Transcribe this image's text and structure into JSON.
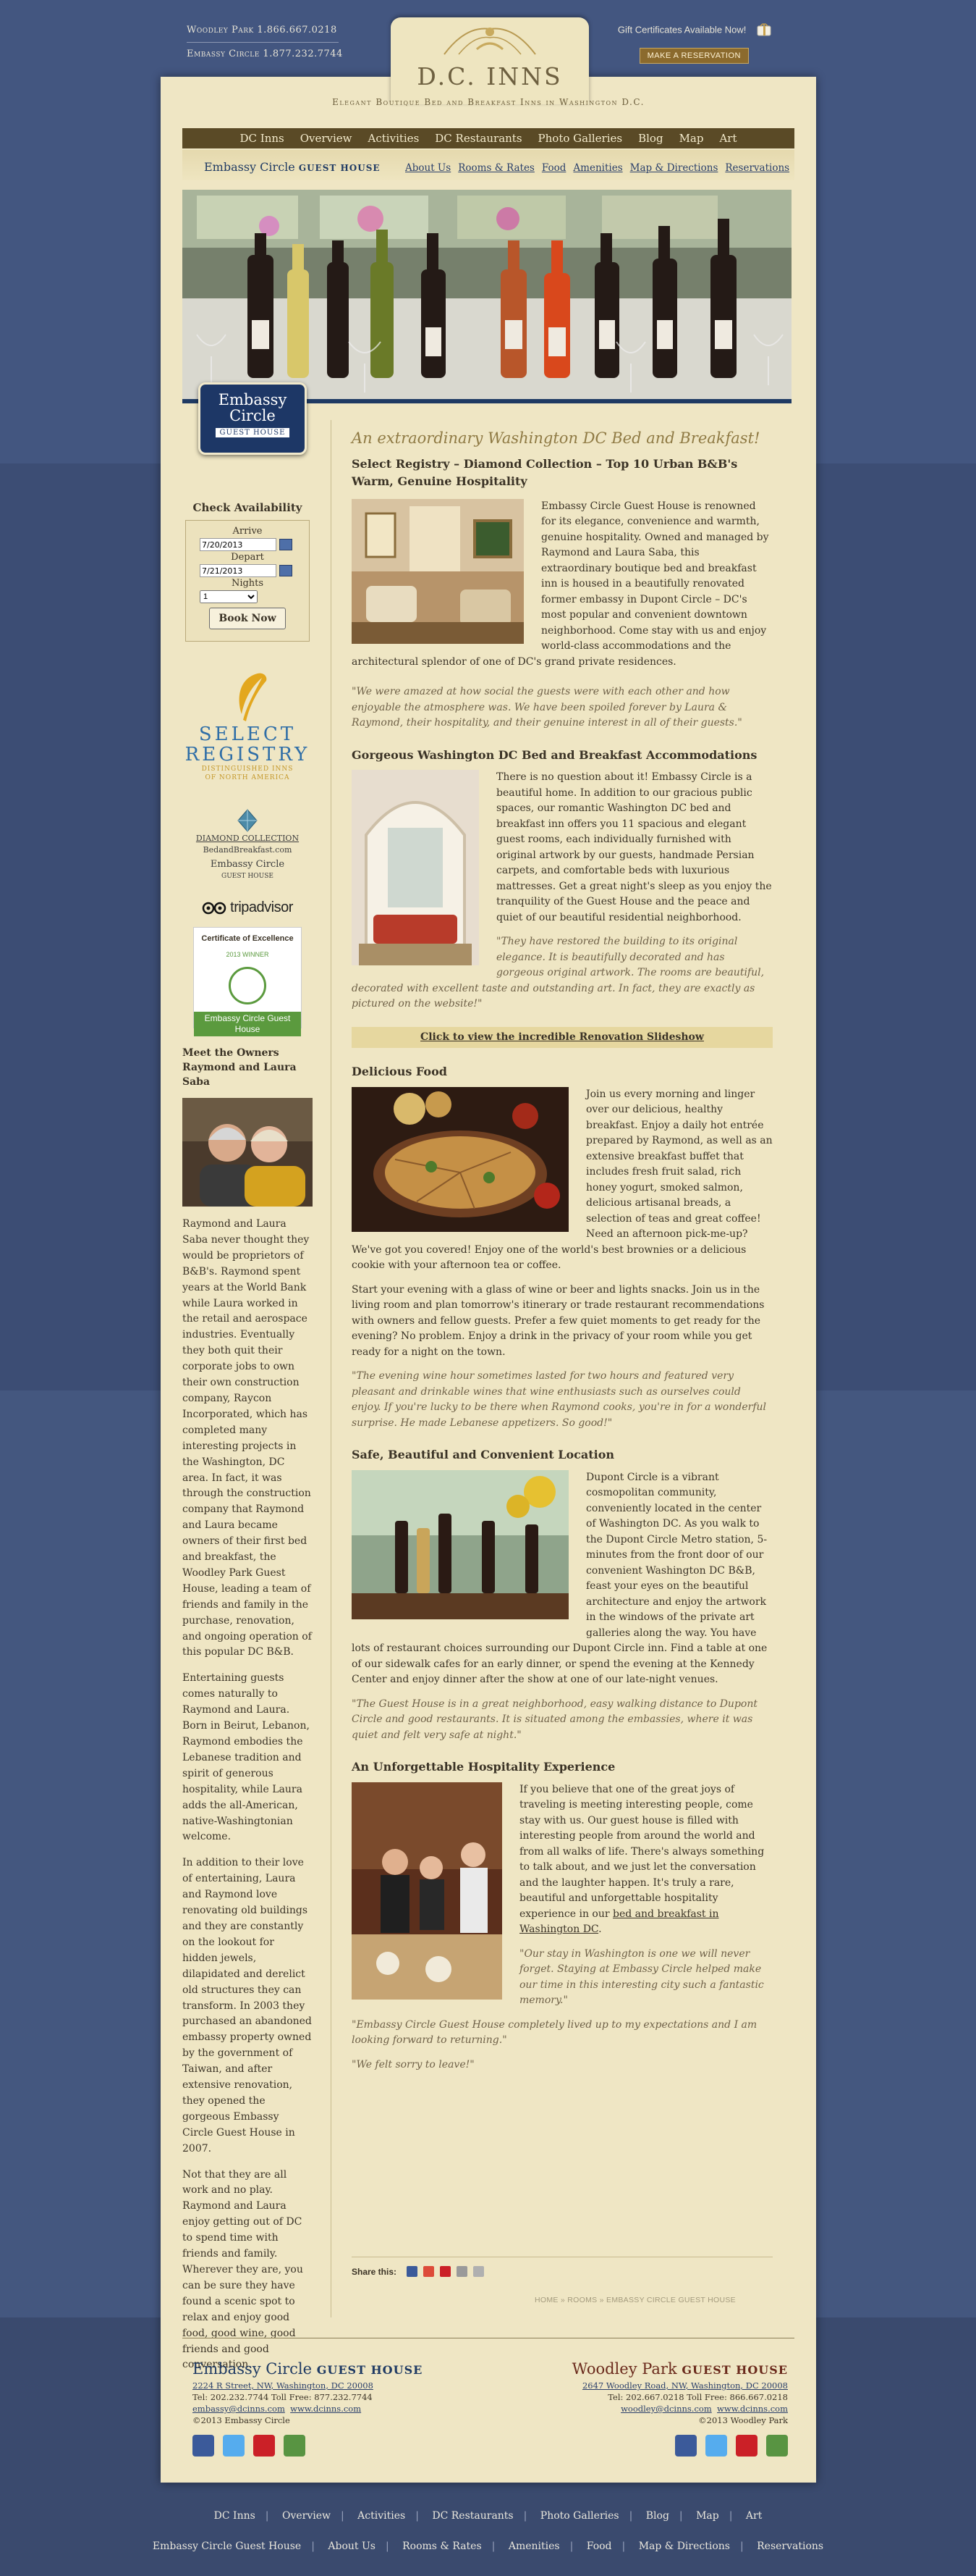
{
  "top": {
    "phone1_label": "Woodley Park",
    "phone1_number": "1.866.667.0218",
    "phone2_label": "Embassy Circle",
    "phone2_number": "1.877.232.7744",
    "gift_text": "Gift Certificates Available Now!",
    "reserve_label": "MAKE A RESERVATION"
  },
  "brand": {
    "title": "D.C. INNS",
    "tagline": "Elegant Boutique Bed and Breakfast Inns in Washington D.C."
  },
  "main_nav": [
    "DC Inns",
    "Overview",
    "Activities",
    "DC Restaurants",
    "Photo Galleries",
    "Blog",
    "Map",
    "Art"
  ],
  "property": {
    "logo_name": "Embassy Circle",
    "logo_suffix": "GUEST HOUSE",
    "badge_line1": "Embassy",
    "badge_line2": "Circle",
    "badge_line3": "GUEST HOUSE"
  },
  "sub_nav": [
    "About Us",
    "Rooms & Rates",
    "Food",
    "Amenities",
    "Map & Directions",
    "Reservations"
  ],
  "sidebar": {
    "availability_title": "Check Availability",
    "arrive_label": "Arrive",
    "arrive_value": "7/20/2013",
    "depart_label": "Depart",
    "depart_value": "7/21/2013",
    "nights_label": "Nights",
    "nights_value": "1",
    "book_label": "Book Now",
    "select_registry_1": "SELECT",
    "select_registry_2": "REGISTRY",
    "select_registry_3": "DISTINGUISHED INNS",
    "select_registry_4": "OF NORTH AMERICA",
    "diamond_1": "DIAMOND COLLECTION",
    "diamond_2": "BedandBreakfast.com",
    "diamond_3": "Embassy Circle",
    "diamond_4": "GUEST HOUSE",
    "tripadvisor": "tripadvisor",
    "cert_1": "Certificate of Excellence",
    "cert_2": "2013 WINNER",
    "cert_3": "Embassy Circle Guest House",
    "owners_heading_1": "Meet the Owners",
    "owners_heading_2": "Raymond and Laura Saba",
    "owners_paragraphs": [
      "Raymond and Laura Saba never thought they would be proprietors of B&B's. Raymond spent years at the World Bank while Laura worked in the retail and aerospace industries. Eventually they both quit their corporate jobs to own their own construction company, Raycon Incorporated, which has completed many interesting projects in the Washington, DC area. In fact, it was through the construction company that Raymond and Laura became owners of their first bed and breakfast, the Woodley Park Guest House, leading a team of friends and family in the purchase, renovation, and ongoing operation of this popular DC B&B.",
      "Entertaining guests comes naturally to Raymond and Laura. Born in Beirut, Lebanon, Raymond embodies the Lebanese tradition and spirit of generous hospitality, while Laura adds the all-American, native-Washingtonian welcome.",
      "In addition to their love of entertaining, Laura and Raymond love renovating old buildings and they are constantly on the lookout for hidden jewels, dilapidated and derelict old structures they can transform. In 2003 they purchased an abandoned embassy property owned by the government of Taiwan, and after extensive renovation, they opened the gorgeous Embassy Circle Guest House in 2007.",
      "Not that they are all work and no play. Raymond and Laura enjoy getting out of DC to spend time with friends and family. Wherever they are, you can be sure they have found a scenic spot to relax and enjoy good food, good wine, good friends and good conversation."
    ]
  },
  "content": {
    "headline": "An extraordinary Washington DC Bed and Breakfast!",
    "subhead1": "Select Registry – Diamond Collection – Top 10 Urban B&B's",
    "subhead2": "Warm, Genuine Hospitality",
    "p1": "Embassy Circle Guest House is renowned for its elegance, convenience and warmth, genuine hospitality. Owned and managed by Raymond and Laura Saba, this extraordinary boutique bed and breakfast inn is housed in a beautifully renovated former embassy in Dupont Circle – DC's most popular and convenient downtown neighborhood. Come stay with us and enjoy world-class accommodations and the architectural splendor of one of DC's grand private residences.",
    "q1": "\"We were amazed at how social the guests were with each other and how enjoyable the atmosphere was. We have been spoiled forever by Laura & Raymond, their hospitality, and their genuine interest in all of their guests.\"",
    "h_accom": "Gorgeous Washington DC Bed and Breakfast Accommodations",
    "p2": "There is no question about it! Embassy Circle is a beautiful home. In addition to our gracious public spaces, our romantic Washington DC bed and breakfast inn offers you 11 spacious and elegant guest rooms, each individually furnished with original artwork by our guests, handmade Persian carpets, and comfortable beds with luxurious mattresses. Get a great night's sleep as you enjoy the tranquility of the Guest House and the peace and quiet of our beautiful residential neighborhood.",
    "q2": "\"They have restored the building to its original elegance. It is beautifully decorated and has gorgeous original artwork. The rooms are beautiful, decorated with excellent taste and outstanding art. In fact, they are exactly as pictured on the website!\"",
    "slideshow_link": "Click to view the incredible Renovation Slideshow",
    "h_food": "Delicious Food",
    "p3": "Join us every morning and linger over our delicious, healthy breakfast. Enjoy a daily hot entrée prepared by Raymond, as well as an extensive breakfast buffet that includes fresh fruit salad, rich honey yogurt, smoked salmon, delicious artisanal breads, a selection of teas and great coffee! Need an afternoon pick-me-up? We've got you covered! Enjoy one of the world's best brownies or a delicious cookie with your afternoon tea or coffee.",
    "p4": "Start your evening with a glass of wine or beer and lights snacks. Join us in the living room and plan tomorrow's itinerary or trade restaurant recommendations with owners and fellow guests. Prefer a few quiet moments to get ready for the evening? No problem. Enjoy a drink in the privacy of your room while you get ready for a night on the town.",
    "q3": "\"The evening wine hour sometimes lasted for two hours and featured very pleasant and drinkable wines that wine enthusiasts such as ourselves could enjoy. If you're lucky to be there when Raymond cooks, you're in for a wonderful surprise. He made Lebanese appetizers. So good!\"",
    "h_safe": "Safe, Beautiful and Convenient Location",
    "p5": "Dupont Circle is a vibrant cosmopolitan community, conveniently located in the center of Washington DC. As you walk to the Dupont Circle Metro station, 5-minutes from the front door of our convenient Washington DC B&B, feast your eyes on the beautiful architecture and enjoy the artwork in the windows of the private art galleries along the way. You have lots of restaurant choices surrounding our Dupont Circle inn. Find a table at one of our sidewalk cafes for an early dinner, or spend the evening at the Kennedy Center and enjoy dinner after the show at one of our late-night venues.",
    "q4": "\"The Guest House is in a great neighborhood, easy walking distance to Dupont Circle and good restaurants. It is situated among the embassies, where it was quiet and felt very safe at night.\"",
    "h_exp": "An Unforgettable Hospitality Experience",
    "p6_before": "If you believe that one of the great joys of traveling is meeting interesting people, come stay with us. Our guest house is filled with interesting people from around the world and from all walks of life. There's always something to talk about, and we just let the conversation and the laughter happen. It's truly a rare, beautiful and unforgettable hospitality experience in our ",
    "p6_link": "bed and breakfast in Washington DC",
    "p6_after": ".",
    "q5": "\"Our stay in Washington is one we will never forget. Staying at Embassy Circle helped make our time in this interesting city such a fantastic memory.\"",
    "q6": "\"Embassy Circle Guest House completely lived up to my expectations and I am looking forward to returning.\"",
    "q7": "\"We felt sorry to leave!\"",
    "share_label": "Share this:",
    "breadcrumb": "HOME » ROOMS » EMBASSY CIRCLE GUEST HOUSE"
  },
  "footer": {
    "left_name": "Embassy Circle",
    "left_suffix": "GUEST HOUSE",
    "left_address": "2224 R Street, NW, Washington, DC 20008",
    "left_phones": "Tel: 202.232.7744   Toll Free: 877.232.7744",
    "left_email": "embassy@dcinns.com",
    "left_web": "www.dcinns.com",
    "left_copy": "©2013 Embassy Circle",
    "right_name": "Woodley Park",
    "right_suffix": "GUEST HOUSE",
    "right_address": "2647 Woodley Road, NW, Washington, DC 20008",
    "right_phones": "Tel: 202.667.0218   Toll Free: 866.667.0218",
    "right_email": "woodley@dcinns.com",
    "right_web": "www.dcinns.com",
    "right_copy": "©2013 Woodley Park"
  },
  "bottom_nav_1": [
    "DC Inns",
    "Overview",
    "Activities",
    "DC Restaurants",
    "Photo Galleries",
    "Blog",
    "Map",
    "Art"
  ],
  "bottom_nav_2": [
    "Embassy Circle Guest House",
    "About Us",
    "Rooms & Rates",
    "Amenities",
    "Food",
    "Map & Directions",
    "Reservations"
  ],
  "colors": {
    "page_bg": "#3e5177",
    "panel_bg": "#efe6c4",
    "nav_bg": "#5a4a26",
    "brand_blue": "#1f3a63",
    "brand_red": "#6a2a1c",
    "accent_gold": "#8f7a44"
  }
}
